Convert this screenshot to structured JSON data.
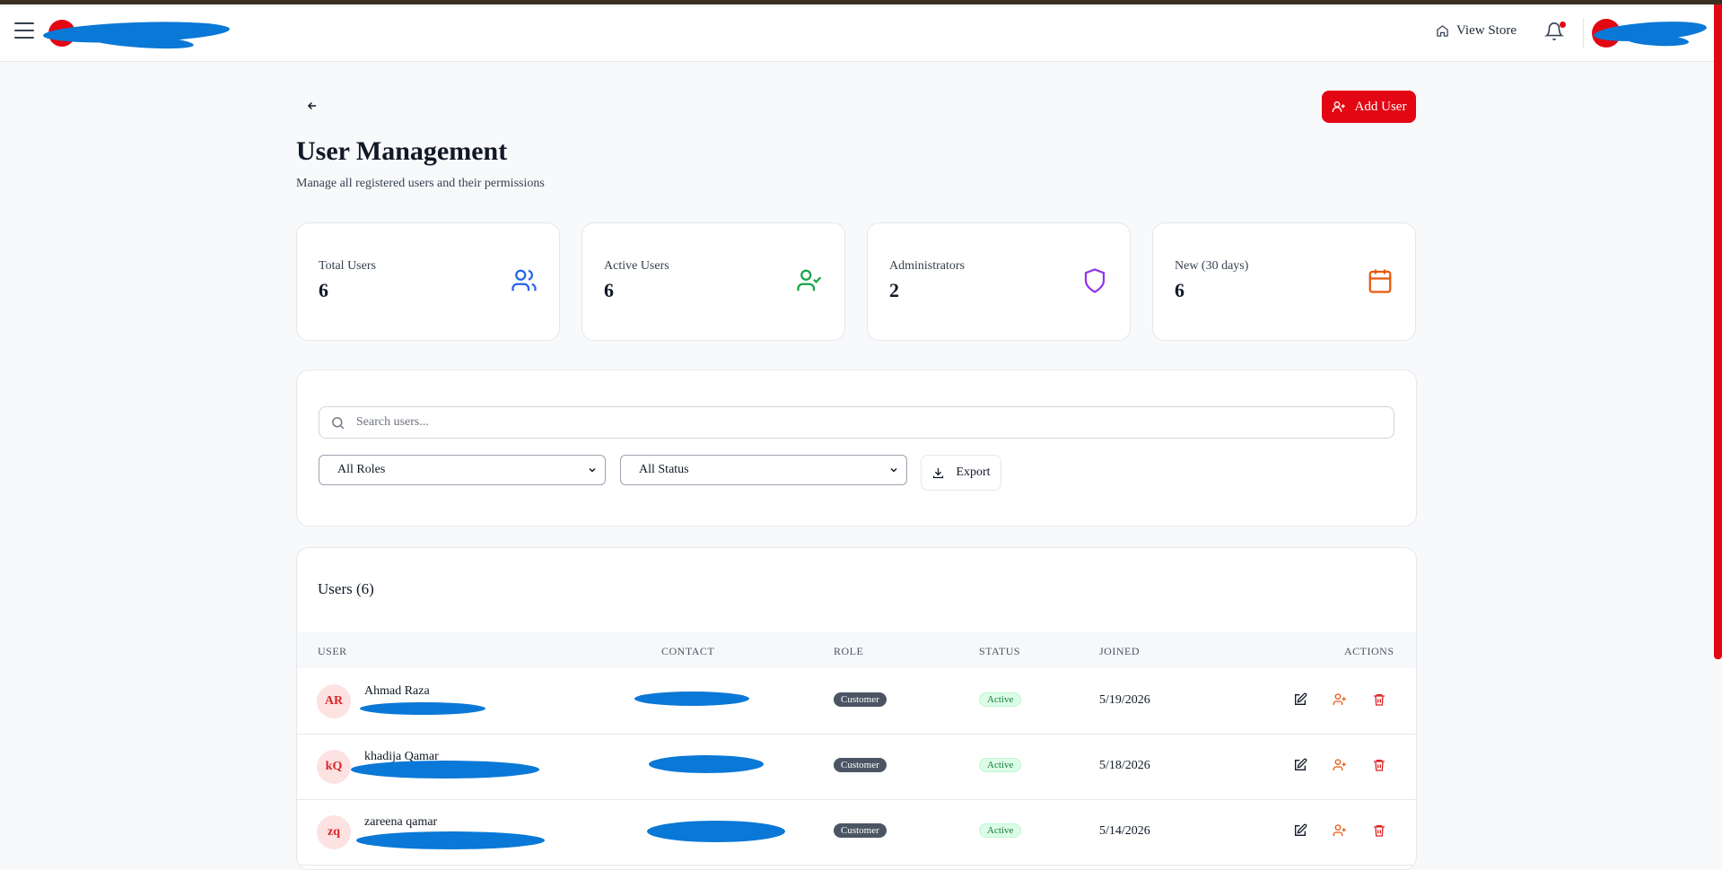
{
  "header": {
    "view_store_label": "View Store"
  },
  "page": {
    "title": "User Management",
    "subtitle": "Manage all registered users and their permissions",
    "add_user_label": "Add User"
  },
  "stats": [
    {
      "label": "Total Users",
      "value": "6",
      "icon": "users-icon",
      "color": "#2563eb"
    },
    {
      "label": "Active Users",
      "value": "6",
      "icon": "user-check-icon",
      "color": "#16a34a"
    },
    {
      "label": "Administrators",
      "value": "2",
      "icon": "shield-icon",
      "color": "#9333ea"
    },
    {
      "label": "New (30 days)",
      "value": "6",
      "icon": "calendar-icon",
      "color": "#ea580c"
    }
  ],
  "filters": {
    "search_placeholder": "Search users...",
    "role_selected": "All Roles",
    "status_selected": "All Status",
    "export_label": "Export"
  },
  "users_table": {
    "title": "Users (6)",
    "columns": [
      "USER",
      "CONTACT",
      "ROLE",
      "STATUS",
      "JOINED",
      "ACTIONS"
    ],
    "rows": [
      {
        "initials": "AR",
        "name": "Ahmad Raza",
        "role": "Customer",
        "status": "Active",
        "joined": "5/19/2026"
      },
      {
        "initials": "kQ",
        "name": "khadija Qamar",
        "role": "Customer",
        "status": "Active",
        "joined": "5/18/2026"
      },
      {
        "initials": "zq",
        "name": "zareena qamar",
        "role": "Customer",
        "status": "Active",
        "joined": "5/14/2026"
      }
    ]
  },
  "colors": {
    "brand": "#e30613",
    "redaction": "#0a78d6"
  }
}
